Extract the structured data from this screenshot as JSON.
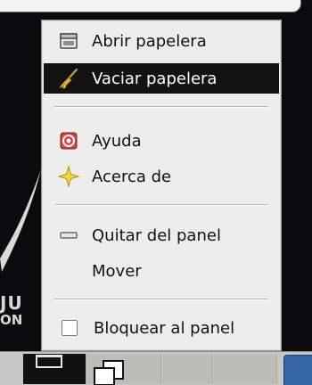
{
  "context_menu": {
    "items": [
      {
        "label": "Abrir papelera",
        "icon": "trash-open-icon",
        "selected": false
      },
      {
        "label": "Vaciar papelera",
        "icon": "broom-icon",
        "selected": true
      },
      {
        "label": "Ayuda",
        "icon": "help-lifebuoy-icon",
        "selected": false
      },
      {
        "label": "Acerca de",
        "icon": "about-star-icon",
        "selected": false
      },
      {
        "label": "Quitar del panel",
        "icon": "remove-minus-icon",
        "selected": false
      },
      {
        "label": "Mover",
        "icon": "",
        "selected": false
      },
      {
        "label": "Bloquear al panel",
        "icon": "checkbox",
        "selected": false
      }
    ]
  },
  "desktop": {
    "wallpaper_text_line1": "JU",
    "wallpaper_text_line2": "ON"
  },
  "colors": {
    "menu_bg": "#ededeb",
    "selected_bg": "#121212",
    "panel_bg": "#c7c7c3",
    "accent_blue": "#3465a4"
  }
}
